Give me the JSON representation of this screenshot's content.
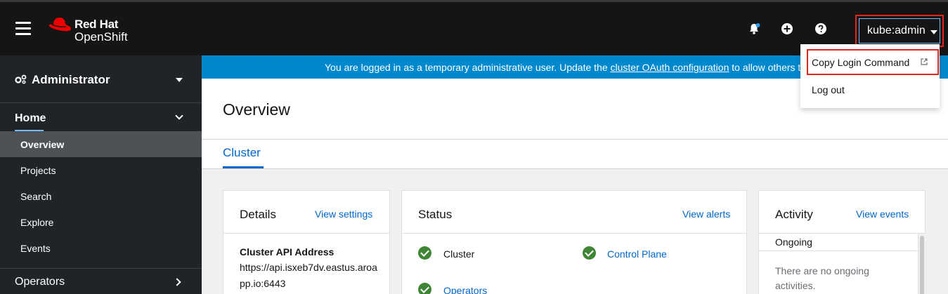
{
  "masthead": {
    "brand_line1": "Red Hat",
    "brand_line2": "OpenShift",
    "user": "kube:admin",
    "icons": [
      "hamburger-icon",
      "bell-icon",
      "plus-circle-icon",
      "question-circle-icon"
    ]
  },
  "sidebar": {
    "perspective": "Administrator",
    "section": "Home",
    "items": [
      {
        "label": "Overview",
        "active": true
      },
      {
        "label": "Projects"
      },
      {
        "label": "Search"
      },
      {
        "label": "Explore"
      },
      {
        "label": "Events"
      }
    ],
    "next_section": "Operators"
  },
  "banner": {
    "text_before": "You are logged in as a temporary administrative user. Update the ",
    "link": "cluster OAuth configuration",
    "text_after": " to allow others to log in."
  },
  "page": {
    "title": "Overview",
    "tab": "Cluster"
  },
  "details": {
    "title": "Details",
    "link": "View settings",
    "field_label": "Cluster API Address",
    "field_value": "https://api.isxeb7dv.eastus.aroapp.io:6443"
  },
  "status": {
    "title": "Status",
    "link": "View alerts",
    "items": [
      "Cluster",
      "Control Plane",
      "Operators"
    ]
  },
  "activity": {
    "title": "Activity",
    "link": "View events",
    "ongoing_label": "Ongoing",
    "empty_text": "There are no ongoing activities."
  },
  "user_menu": {
    "items": [
      "Copy Login Command",
      "Log out"
    ]
  },
  "colors": {
    "masthead": "#151515",
    "sidebar": "#212427",
    "banner": "#0088ce",
    "link": "#0066cc",
    "success": "#3e8635",
    "highlight": "#e3251b"
  }
}
